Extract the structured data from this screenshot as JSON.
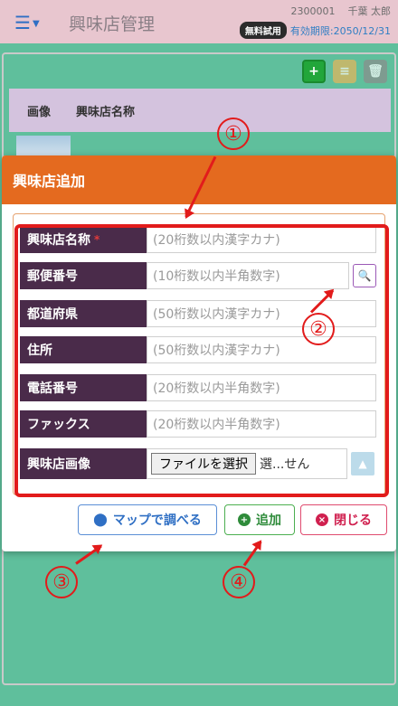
{
  "header": {
    "menu_icon": "hamburger-icon",
    "title": "興味店管理",
    "user_id": "2300001",
    "user_name": "千葉 太郎",
    "trial_badge": "無料試用",
    "expiry": "有効期限:2050/12/31"
  },
  "toolbar": {
    "add_icon": "plus-circle-icon",
    "db_icon": "database-icon",
    "delete_icon": "trash-icon"
  },
  "table": {
    "columns": [
      "画像",
      "興味店名称"
    ]
  },
  "modal": {
    "title": "興味店追加",
    "fields": [
      {
        "label": "興味店名称",
        "required_mark": "*",
        "placeholder": "(20桁数以内漢字カナ)"
      },
      {
        "label": "郵便番号",
        "placeholder": "(10桁数以内半角数字)"
      },
      {
        "label": "都道府県",
        "placeholder": "(50桁数以内漢字カナ)"
      },
      {
        "label": "住所",
        "placeholder": "(50桁数以内漢字カナ)"
      },
      {
        "label": "電話番号",
        "placeholder": "(20桁数以内半角数字)"
      },
      {
        "label": "ファックス",
        "placeholder": "(20桁数以内半角数字)"
      },
      {
        "label": "興味店画像",
        "file_button": "ファイルを選択",
        "file_status": "選...せん"
      }
    ],
    "buttons": {
      "map": "マップで調べる",
      "add": "追加",
      "close": "閉じる"
    }
  },
  "annotations": [
    "①",
    "②",
    "③",
    "④"
  ],
  "colors": {
    "header_bg": "#e8c6cf",
    "page_bg": "#5fbf9c",
    "modal_header": "#e46a1f",
    "label_bg": "#4a2b4a",
    "annotation_red": "#e21b1b"
  }
}
